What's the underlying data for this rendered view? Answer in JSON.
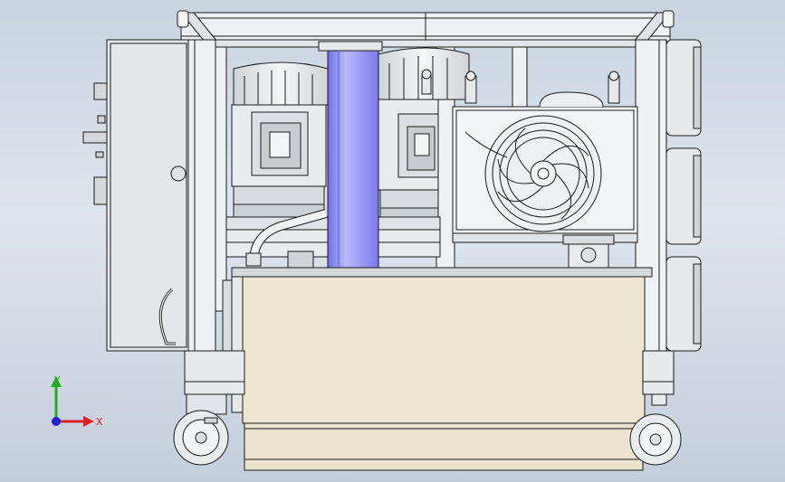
{
  "viewport": {
    "background_top": "#c9d4e0",
    "background_bottom": "#c4cedb"
  },
  "colors": {
    "line": "#1a1a1a",
    "metal": "#e8ecef",
    "metal_shade": "#bfc5cb",
    "tank": "#efe6d2",
    "pipe": "#8f8ff2",
    "pipe_light": "#c9c9fb",
    "panel": "#e3e6ea"
  },
  "triad": {
    "y_label": "Y",
    "x_label": "X",
    "y_color": "#22aa22",
    "x_color": "#dd2222",
    "z_color": "#2222dd"
  }
}
